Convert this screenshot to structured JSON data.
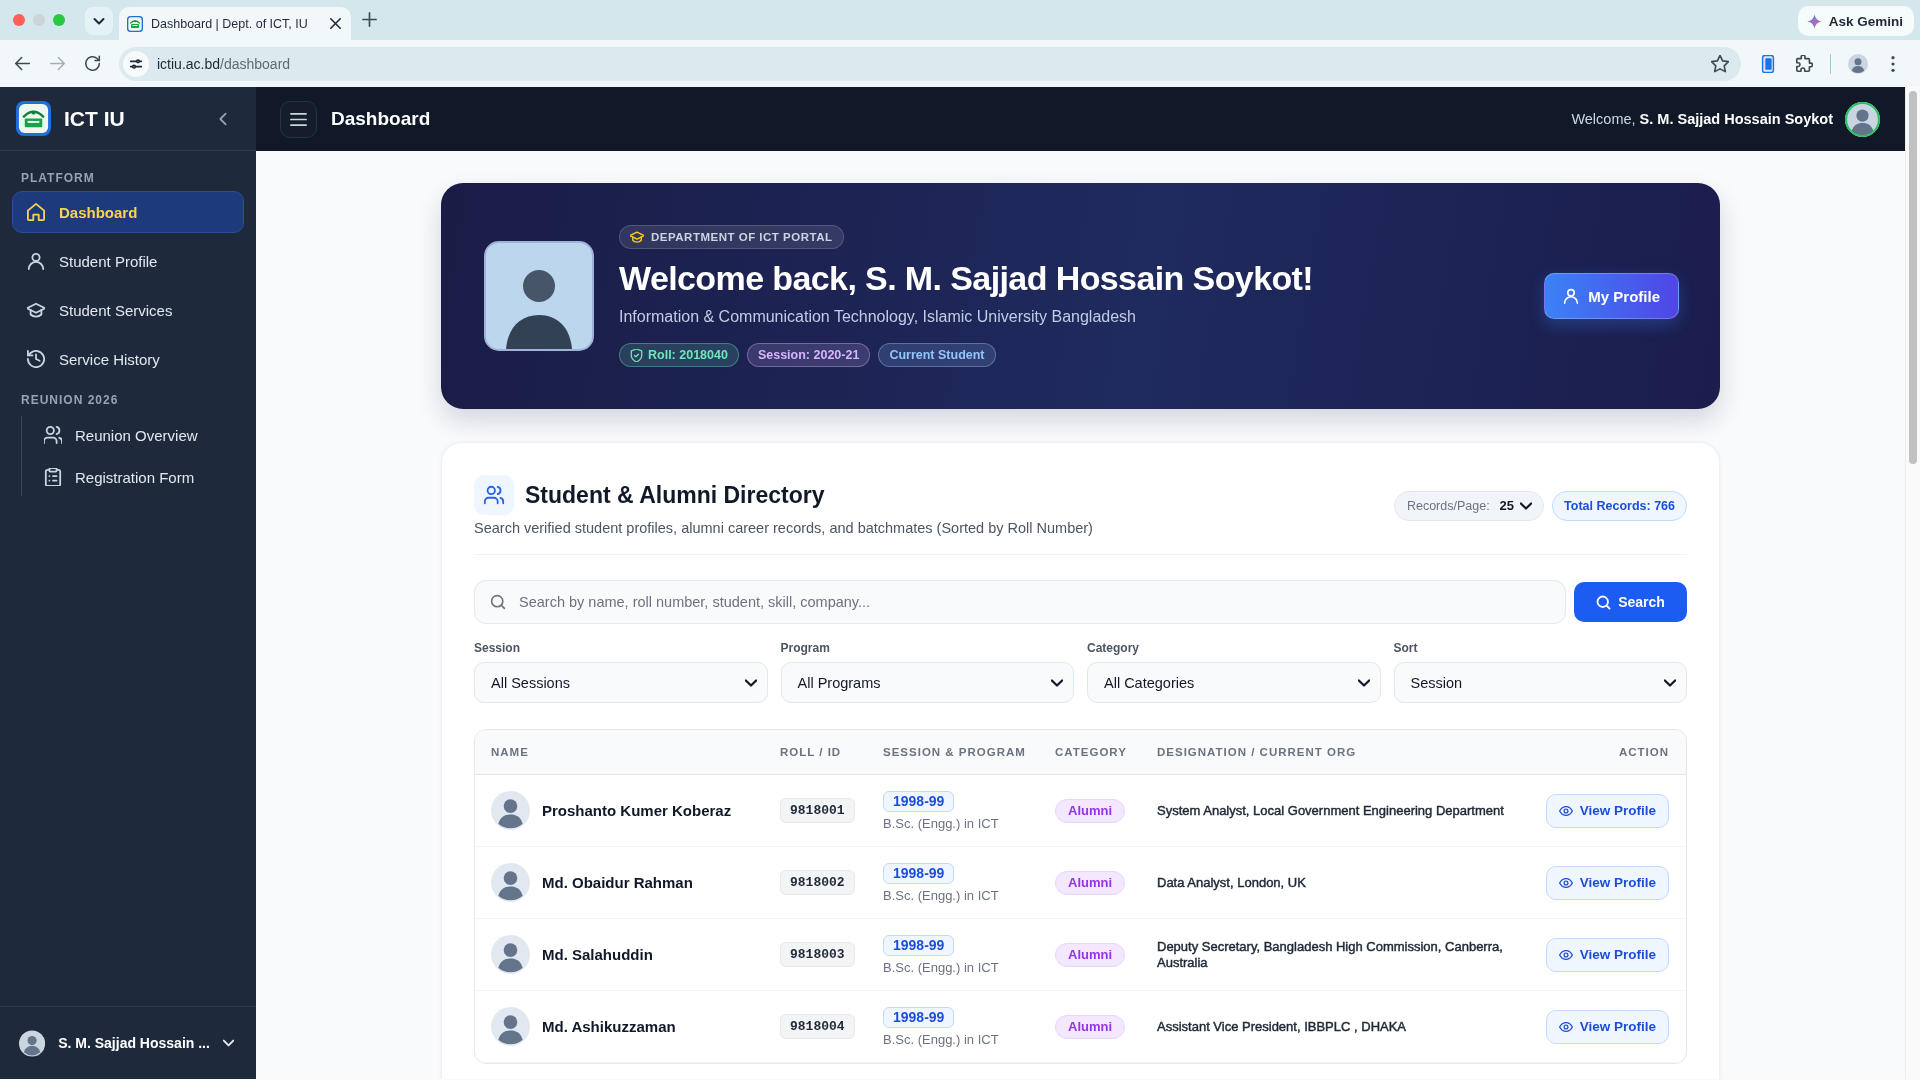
{
  "browser": {
    "tab": {
      "title": "Dashboard | Dept. of ICT, IU",
      "selected": true
    },
    "nav_buttons": [
      {
        "kind": "back",
        "disabled": false
      },
      {
        "kind": "forward",
        "disabled": true
      },
      {
        "kind": "reload",
        "disabled": false
      }
    ],
    "url": {
      "host": "ictiu.ac.bd",
      "path": "/dashboard"
    },
    "gemini_button": "Ask Gemini"
  },
  "sidebar": {
    "brand": "ICT IU",
    "sections": [
      {
        "title": "PLATFORM",
        "kind": "plain",
        "items": [
          {
            "label": "Dashboard",
            "selected": true
          },
          {
            "label": "Student Profile",
            "selected": false
          },
          {
            "label": "Student Services",
            "selected": false
          },
          {
            "label": "Service History",
            "selected": false
          }
        ]
      },
      {
        "title": "REUNION 2026",
        "kind": "indented",
        "items": [
          {
            "label": "Reunion Overview",
            "selected": false
          },
          {
            "label": "Registration Form",
            "selected": false
          }
        ]
      }
    ],
    "user_name": "S. M. Sajjad Hossain ..."
  },
  "header": {
    "title": "Dashboard",
    "welcome": "Welcome, **S. M. Sajjad Hossain Soykot**"
  },
  "hero": {
    "badge": "DEPARTMENT OF ICT PORTAL",
    "title": "Welcome back, S. M. Sajjad Hossain Soykot!",
    "subtitle": "Information & Communication Technology, Islamic University Bangladesh",
    "chips": [
      {
        "kind": "verified",
        "label": "Roll: 2018040",
        "color": "#6ee7b7"
      },
      {
        "kind": "plain",
        "label": "Session: 2020-21",
        "color": "#d8b4fe"
      },
      {
        "kind": "plain",
        "label": "Current Student",
        "color": "#93c5fd"
      }
    ],
    "button": "My Profile"
  },
  "directory": {
    "title": "Student & Alumni Directory",
    "subtitle": "Search verified student profiles, alumni career records, and batchmates (Sorted by Roll Number)",
    "records_per_page": {
      "label": "Records/Page:",
      "value": "25"
    },
    "total_records": "Total Records: 766",
    "search": {
      "placeholder": "Search by name, roll number, student, skill, company...",
      "button": "Search"
    },
    "filters": [
      {
        "label": "Session",
        "value": "All Sessions"
      },
      {
        "label": "Program",
        "value": "All Programs"
      },
      {
        "label": "Category",
        "value": "All Categories"
      },
      {
        "label": "Sort",
        "value": "Session"
      }
    ],
    "table": {
      "columns": [
        "NAME",
        "ROLL / ID",
        "SESSION & PROGRAM",
        "CATEGORY",
        "DESIGNATION / CURRENT ORG",
        "ACTION"
      ],
      "rows": [
        {
          "name": "Proshanto Kumer Koberaz",
          "roll": "9818001",
          "session": "1998-99",
          "program": "B.Sc. (Engg.) in ICT",
          "category": "Alumni",
          "designation": "System Analyst, Local Government Engineering Department",
          "action": "View Profile"
        },
        {
          "name": "Md. Obaidur Rahman",
          "roll": "9818002",
          "session": "1998-99",
          "program": "B.Sc. (Engg.) in ICT",
          "category": "Alumni",
          "designation": "Data Analyst, London, UK",
          "action": "View Profile"
        },
        {
          "name": "Md. Salahuddin",
          "roll": "9818003",
          "session": "1998-99",
          "program": "B.Sc. (Engg.) in ICT",
          "category": "Alumni",
          "designation": "Deputy Secretary, Bangladesh High Commission, Canberra, Australia",
          "action": "View Profile"
        },
        {
          "name": "Md. Ashikuzzaman",
          "roll": "9818004",
          "session": "1998-99",
          "program": "B.Sc. (Engg.) in ICT",
          "category": "Alumni",
          "designation": "Assistant Vice President, IBBPLC , DHAKA",
          "action": "View Profile"
        }
      ]
    }
  }
}
